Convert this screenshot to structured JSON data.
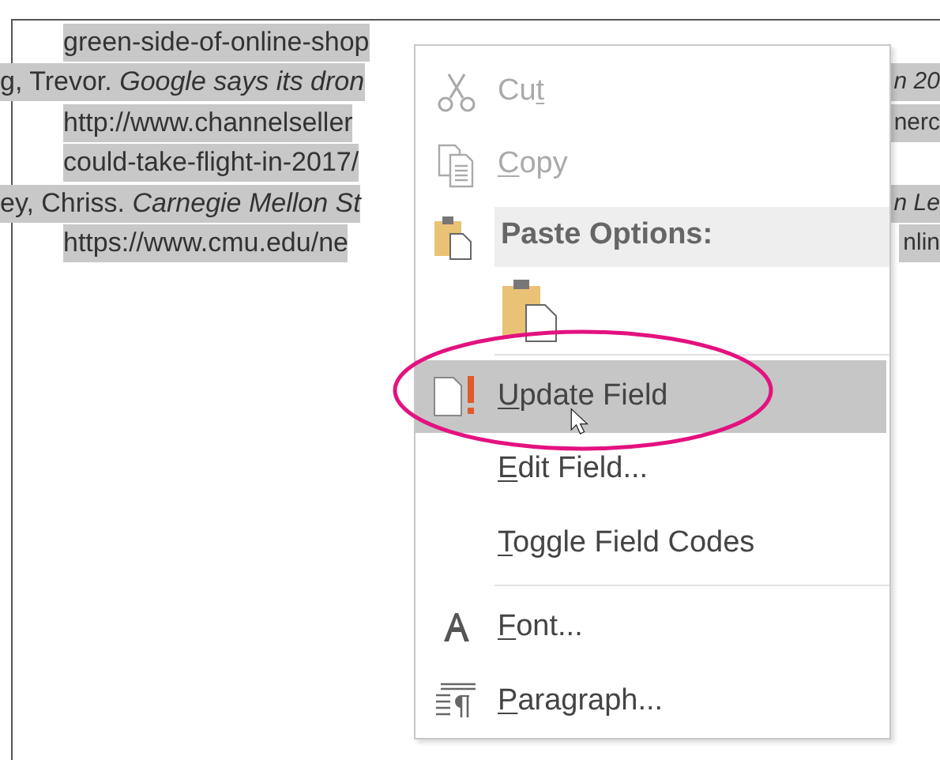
{
  "document": {
    "lines": [
      {
        "text": "green-side-of-online-shop",
        "kind": "continuation"
      },
      {
        "text": "g, Trevor. *Google says its dron*",
        "kind": "entry",
        "right": "*n 20*"
      },
      {
        "text": "http://www.channelseller",
        "kind": "continuation",
        "right": "nerc"
      },
      {
        "text": "could-take-flight-in-2017/",
        "kind": "continuation"
      },
      {
        "text": "ey, Chriss. *Carnegie Mellon St*",
        "kind": "entry",
        "right": "*n Le*"
      },
      {
        "text": "https://www.cmu.edu/ne",
        "kind": "continuation",
        "right": "nlin"
      }
    ]
  },
  "context_menu": {
    "items": [
      {
        "kind": "command",
        "pre": "Cu",
        "key": "t",
        "disabled": true,
        "selected": false
      },
      {
        "kind": "command",
        "key": "C",
        "post": "opy",
        "disabled": true,
        "selected": false
      },
      {
        "kind": "header",
        "label": "Paste Options:"
      },
      {
        "kind": "paste_option"
      },
      {
        "kind": "separator"
      },
      {
        "kind": "command",
        "key": "U",
        "post": "pdate Field",
        "disabled": false,
        "selected": true
      },
      {
        "kind": "command",
        "key": "E",
        "post": "dit Field...",
        "disabled": false,
        "selected": false
      },
      {
        "kind": "command",
        "key": "T",
        "post": "oggle Field Codes",
        "disabled": false,
        "selected": false
      },
      {
        "kind": "separator"
      },
      {
        "kind": "command",
        "key": "F",
        "post": "ont...",
        "disabled": false,
        "selected": false
      },
      {
        "kind": "command",
        "key": "P",
        "post": "aragraph...",
        "disabled": false,
        "selected": false
      }
    ]
  }
}
